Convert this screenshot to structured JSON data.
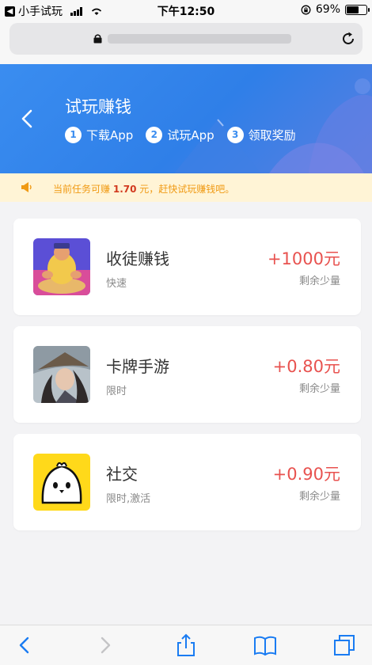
{
  "status_bar": {
    "back_app": "小手试玩",
    "time": "下午12:50",
    "battery": "69%",
    "battery_level": 0.69
  },
  "header": {
    "title": "试玩赚钱",
    "steps": [
      {
        "num": "1",
        "label": "下载App"
      },
      {
        "num": "2",
        "label": "试玩App"
      },
      {
        "num": "3",
        "label": "领取奖励"
      }
    ]
  },
  "notice": {
    "prefix": "当前任务可赚",
    "amount": "1.70",
    "suffix": "元，赶快试玩赚钱吧。"
  },
  "tasks": [
    {
      "name": "收徒赚钱",
      "tag": "快速",
      "reward": "+1000元",
      "remain": "剩余少量"
    },
    {
      "name": "卡牌手游",
      "tag": "限时",
      "reward": "+0.80元",
      "remain": "剩余少量"
    },
    {
      "name": "社交",
      "tag": "限时,激活",
      "reward": "+0.90元",
      "remain": "剩余少量"
    }
  ],
  "colors": {
    "accent": "#3a8df0",
    "reward": "#e8524f",
    "notice_bg": "#fff4d6",
    "notice_text": "#f09a14"
  }
}
